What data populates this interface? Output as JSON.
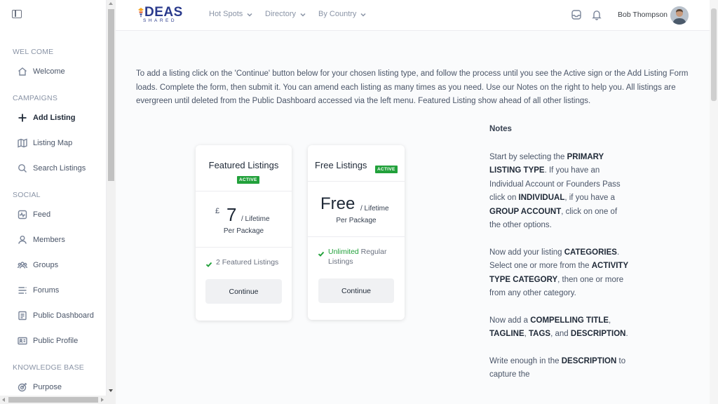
{
  "sidebar": {
    "sections": [
      {
        "label": "WEL COME",
        "items": [
          {
            "label": "Welcome",
            "icon": "home-icon"
          }
        ]
      },
      {
        "label": "CAMPAIGNS",
        "items": [
          {
            "label": "Add Listing",
            "icon": "plus-icon"
          },
          {
            "label": "Listing Map",
            "icon": "map-icon"
          },
          {
            "label": "Search Listings",
            "icon": "search-icon"
          }
        ]
      },
      {
        "label": "SOCIAL",
        "items": [
          {
            "label": "Feed",
            "icon": "activity-icon"
          },
          {
            "label": "Members",
            "icon": "user-icon"
          },
          {
            "label": "Groups",
            "icon": "users-icon"
          },
          {
            "label": "Forums",
            "icon": "list-icon"
          },
          {
            "label": "Public Dashboard",
            "icon": "document-icon"
          },
          {
            "label": "Public Profile",
            "icon": "id-card-icon"
          }
        ]
      },
      {
        "label": "KNOWLEDGE BASE",
        "items": [
          {
            "label": "Purpose",
            "icon": "target-icon"
          }
        ]
      }
    ]
  },
  "header": {
    "logo": {
      "word": "DEAS",
      "sub": "SHARED"
    },
    "nav": [
      "Hot Spots",
      "Directory",
      "By Country"
    ],
    "user_name": "Bob Thompson"
  },
  "intro": "To add a listing click on the 'Continue' button below for your chosen listing type, and follow the process until you see the Active sign or the Add Listing Form loads. Complete the form, then submit it. You can amend each listing as many times as you need. Use our Notes on the right to help you. All listings are evergreen until deleted from the Public Dashboard accessed via the left menu. Featured Listing show ahead of all other listings.",
  "cards": [
    {
      "title": "Featured Listings",
      "badge": "ACTIVE",
      "currency": "£",
      "price": "7",
      "unit": "/ Lifetime",
      "per": "Per Package",
      "feature_highlight": "",
      "feature_text": "2 Featured Listings",
      "button": "Continue"
    },
    {
      "title": "Free Listings",
      "badge": "ACTIVE",
      "currency": "",
      "price": "Free",
      "unit": "/ Lifetime",
      "per": "Per Package",
      "feature_highlight": "Unlimited",
      "feature_text": " Regular Listings",
      "button": "Continue"
    }
  ],
  "notes": {
    "title": "Notes",
    "p1": {
      "t1": "Start by selecting the ",
      "b1": "PRIMARY LISTING TYPE",
      "t2": ". If you have an Individual Account or Founders Pass click on ",
      "b2": "INDIVIDUAL",
      "t3": ", if you have a ",
      "b3": "GROUP ACCOUNT",
      "t4": ", click on one of the other options."
    },
    "p2": {
      "t1": "Now add your listing ",
      "b1": "CATEGORIES",
      "t2": ". Select one or more from the ",
      "b2": "ACTIVITY TYPE CATEGORY",
      "t3": ", then one or more from any other category."
    },
    "p3": {
      "t1": "Now add a ",
      "b1": "COMPELLING TITLE",
      "t2": ", ",
      "b2": "TAGLINE",
      "t3": ", ",
      "b3": "TAGS",
      "t4": ", and ",
      "b4": "DESCRIPTION",
      "t5": "."
    },
    "p4": {
      "t1": "Write enough in the ",
      "b1": "DESCRIPTION",
      "t2": " to capture the"
    }
  },
  "colors": {
    "accent_green": "#22a13b",
    "logo_blue": "#2a3a8c"
  }
}
